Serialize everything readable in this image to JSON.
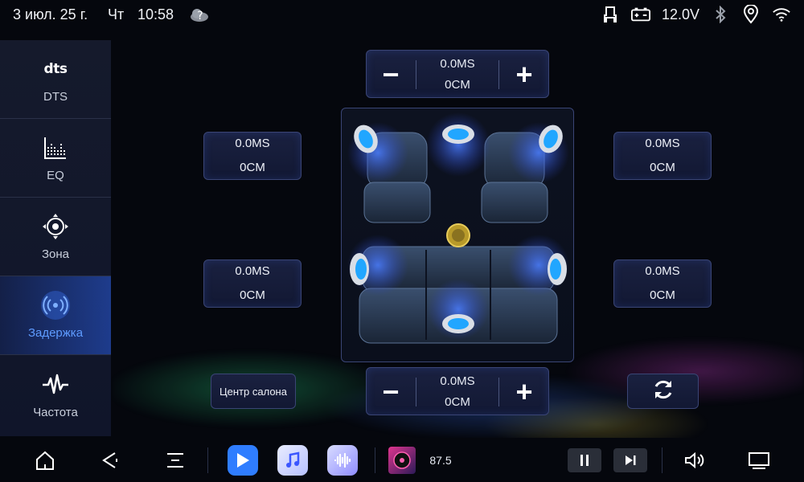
{
  "status": {
    "date": "3 июл. 25 г.",
    "day": "Чт",
    "time": "10:58",
    "voltage": "12.0V",
    "icons": [
      "weather-icon",
      "seat-icon",
      "battery-icon",
      "bluetooth-icon",
      "location-icon",
      "wifi-icon"
    ]
  },
  "sidebar": {
    "items": [
      {
        "label": "DTS",
        "icon": "dts-logo-icon",
        "logo_text": "dts"
      },
      {
        "label": "EQ",
        "icon": "equalizer-icon"
      },
      {
        "label": "Зона",
        "icon": "zone-target-icon"
      },
      {
        "label": "Задержка",
        "icon": "delay-signal-icon",
        "active": true
      },
      {
        "label": "Частота",
        "icon": "frequency-wave-icon"
      }
    ]
  },
  "delay": {
    "top": {
      "ms": "0.0MS",
      "cm": "0CM"
    },
    "bottom": {
      "ms": "0.0MS",
      "cm": "0CM"
    },
    "front_left": {
      "ms": "0.0MS",
      "cm": "0CM"
    },
    "front_right": {
      "ms": "0.0MS",
      "cm": "0CM"
    },
    "rear_left": {
      "ms": "0.0MS",
      "cm": "0CM"
    },
    "rear_right": {
      "ms": "0.0MS",
      "cm": "0CM"
    }
  },
  "buttons": {
    "centre": "Центр салона",
    "minus": "−",
    "plus": "+"
  },
  "bottom": {
    "radio_freq": "87.5"
  },
  "colors": {
    "accent": "#3b7bff",
    "active_text": "#5e9bff",
    "panel_border": "#3a4575"
  }
}
